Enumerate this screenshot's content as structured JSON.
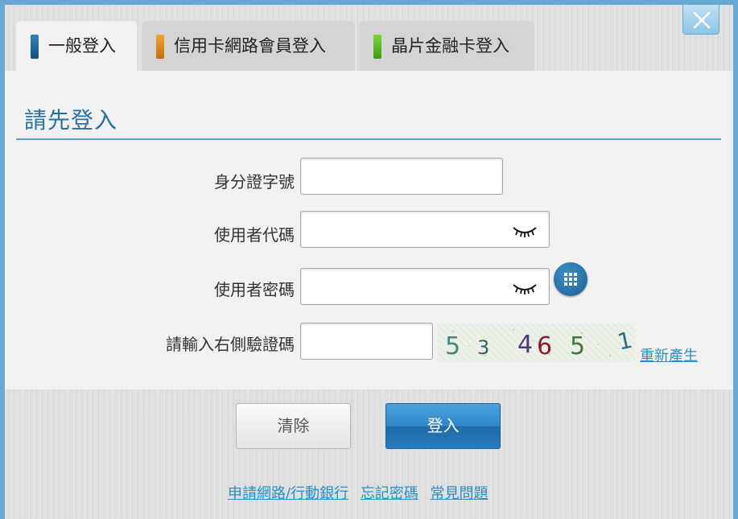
{
  "colors": {
    "general_tab_swatch": "#1e6ea6",
    "credit_tab_swatch": "#e08a12",
    "chip_tab_swatch": "#5cbb1a",
    "accent_blue": "#2a6fa6",
    "link_blue": "#2a8fc8"
  },
  "tabs": [
    {
      "label": "一般登入",
      "selected": true
    },
    {
      "label": "信用卡網路會員登入",
      "selected": false
    },
    {
      "label": "晶片金融卡登入",
      "selected": false
    }
  ],
  "panel": {
    "title": "請先登入"
  },
  "form": {
    "id_label": "身分證字號",
    "id_value": "",
    "user_label": "使用者代碼",
    "user_value": "",
    "password_label": "使用者密碼",
    "password_value": "",
    "captcha_label": "請輸入右側驗證碼",
    "captcha_value": "",
    "captcha_chars": [
      "5",
      "3",
      "4",
      "6",
      "5",
      "1"
    ],
    "regenerate_label": "重新產生"
  },
  "icons": {
    "close": "close-icon",
    "eye": "eye-closed-icon",
    "keypad": "keypad-icon"
  },
  "buttons": {
    "clear_label": "清除",
    "login_label": "登入"
  },
  "footer": {
    "apply_link": "申請網路/行動銀行",
    "forgot_link": "忘記密碼",
    "faq_link": "常見問題"
  }
}
